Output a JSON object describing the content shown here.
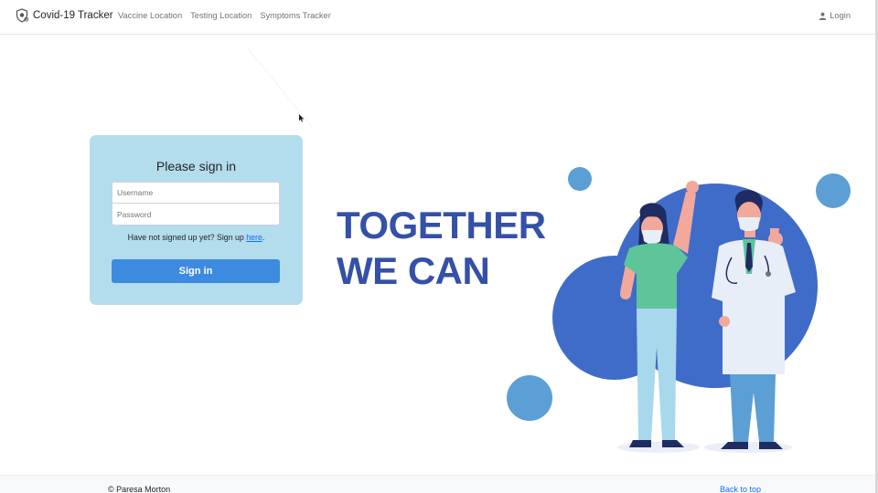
{
  "navbar": {
    "brand": "Covid-19 Tracker",
    "brand_icon": "shield-virus-icon",
    "links": [
      "Vaccine Location",
      "Testing Location",
      "Symptoms Tracker"
    ],
    "login_label": "Login",
    "login_icon": "user-icon"
  },
  "signin": {
    "title": "Please sign in",
    "username_placeholder": "Username",
    "password_placeholder": "Password",
    "signup_prefix": "Have not signed up yet? Sign up ",
    "signup_link": "here",
    "signup_suffix": ".",
    "button_label": "Sign in",
    "card_color": "#b3dcec",
    "button_color": "#3d8be0"
  },
  "headline": {
    "line1": "TOGETHER",
    "line2": "WE CAN",
    "color": "#3450a7"
  },
  "footer": {
    "copyright": "© Paresa Morton",
    "back_to_top": "Back to top"
  }
}
